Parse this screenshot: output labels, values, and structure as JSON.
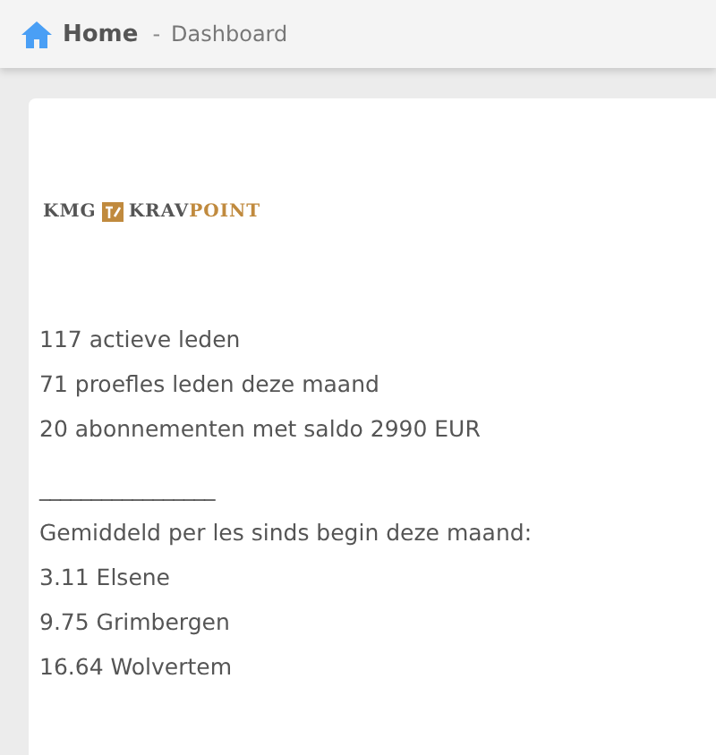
{
  "breadcrumb": {
    "home": "Home",
    "separator": "-",
    "current": "Dashboard"
  },
  "logo": {
    "left": "KMG",
    "middle": "KRAV",
    "right": "POINT"
  },
  "lines": [
    {
      "kind": "text",
      "text": "117 actieve leden"
    },
    {
      "kind": "text",
      "text": "71 proefles leden deze maand"
    },
    {
      "kind": "text",
      "text": "20 abonnementen met saldo 2990 EUR"
    },
    {
      "kind": "rule",
      "text": "_________________"
    },
    {
      "kind": "text",
      "text": "Gemiddeld per les sinds begin deze maand:"
    },
    {
      "kind": "text",
      "text": "3.11 Elsene"
    },
    {
      "kind": "text",
      "text": "9.75 Grimbergen"
    },
    {
      "kind": "text",
      "text": "16.64 Wolvertem"
    }
  ]
}
